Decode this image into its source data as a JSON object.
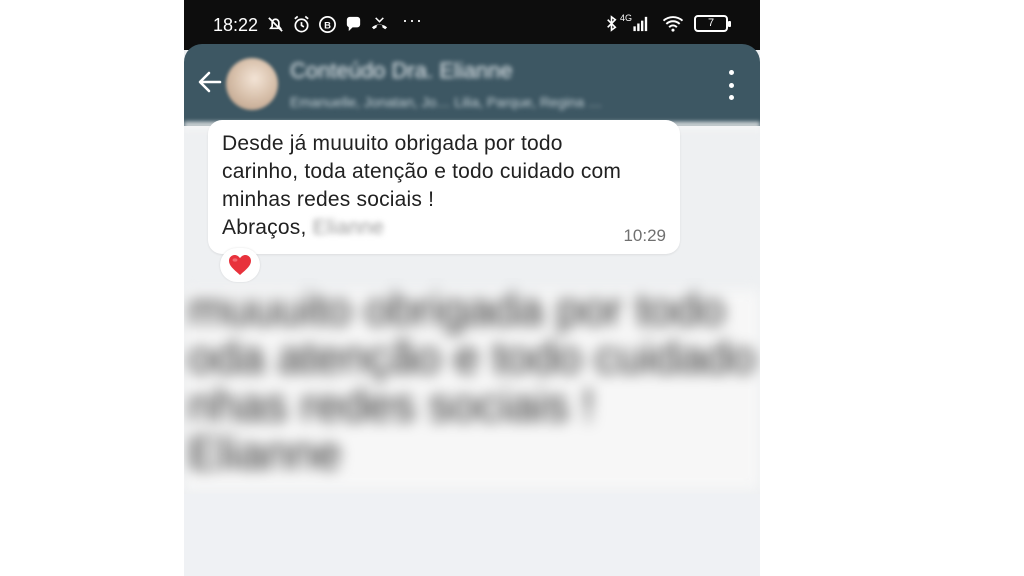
{
  "status_bar": {
    "time": "18:22",
    "network": "4G",
    "battery": "7",
    "overflow": "···",
    "icons": [
      "notifications-muted-icon",
      "alarm-icon",
      "b-app-icon",
      "chat-bubble-icon",
      "missed-call-icon",
      "bluetooth-icon",
      "signal-icon",
      "wifi-icon",
      "battery-icon"
    ]
  },
  "header": {
    "title": "Conteúdo Dra. Elianne",
    "subtitle": "Emanuelle, Jonatan, Jo… Lilia, Parque, Regina …",
    "bg_color": "#3d5763"
  },
  "message": {
    "lines": [
      "Desde já muuuito obrigada por todo",
      "carinho, toda atenção e todo cuidado com",
      "minhas redes sociais !"
    ],
    "greeting": "Abraços,",
    "signature": "Elianne",
    "time": "10:29",
    "reaction": "❤️"
  },
  "blurred_echo": {
    "lines": [
      "muuuito obrigada por todo",
      "oda atenção e todo cuidado c",
      "nhas redes sociais !",
      "Elianne"
    ]
  }
}
